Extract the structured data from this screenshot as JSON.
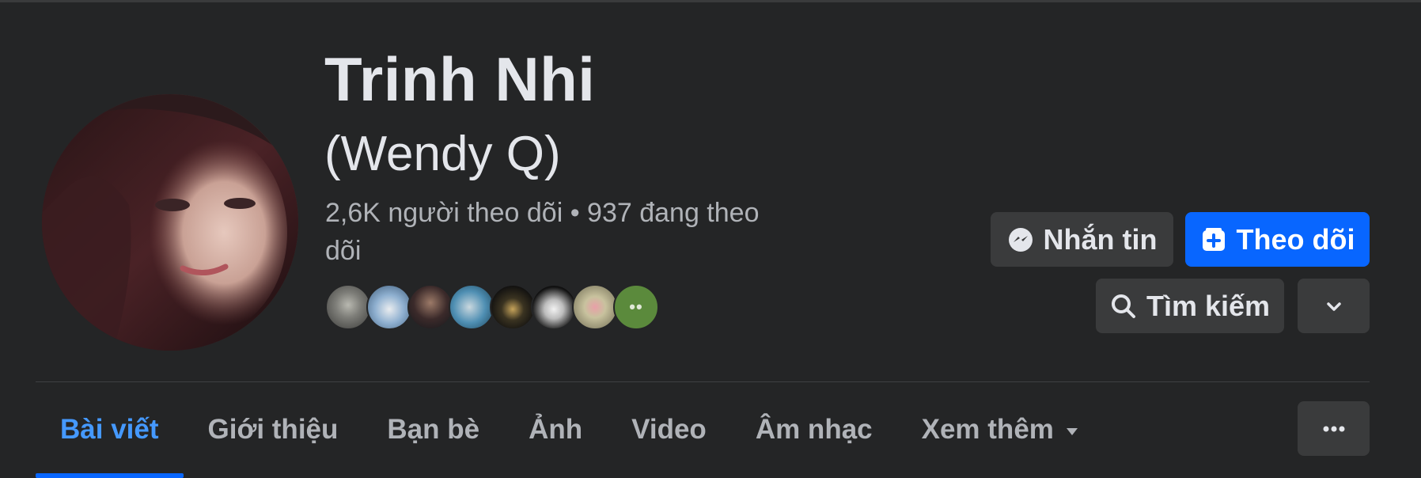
{
  "profile": {
    "name": "Trinh Nhi",
    "alternate_name": "(Wendy Q)",
    "stats_line": "2,6K người theo dõi • 937 đang theo dõi"
  },
  "actions": {
    "message_label": "Nhắn tin",
    "follow_label": "Theo dõi",
    "search_label": "Tìm kiếm"
  },
  "tabs": [
    {
      "label": "Bài viết",
      "active": true
    },
    {
      "label": "Giới thiệu",
      "active": false
    },
    {
      "label": "Bạn bè",
      "active": false
    },
    {
      "label": "Ảnh",
      "active": false
    },
    {
      "label": "Video",
      "active": false
    },
    {
      "label": "Âm nhạc",
      "active": false
    },
    {
      "label": "Xem thêm",
      "active": false
    }
  ],
  "icons": {
    "message": "messenger-icon",
    "follow": "follow-icon",
    "search": "search-icon",
    "dropdown": "chevron-down-icon",
    "more": "ellipsis-icon"
  },
  "colors": {
    "background": "#242526",
    "primary": "#0866ff",
    "active_tab": "#4599ff",
    "secondary_button": "#3a3b3c",
    "text_primary": "#e4e6eb",
    "text_secondary": "#b0b3b8"
  }
}
